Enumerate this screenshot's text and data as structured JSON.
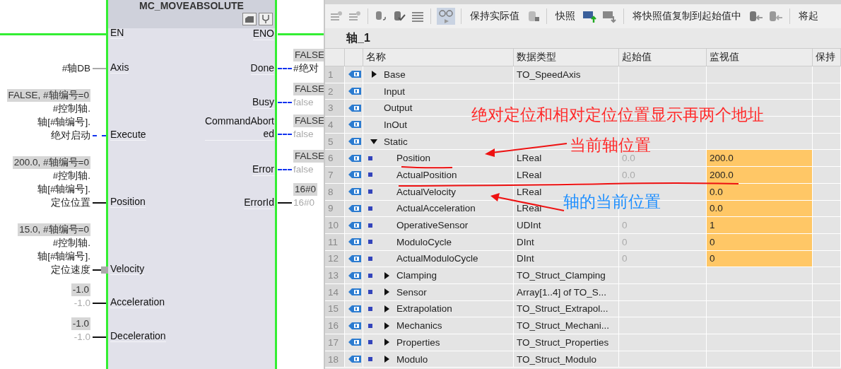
{
  "block": {
    "title": "MC_MOVEABSOLUTE",
    "inputs": [
      {
        "pin": "EN",
        "kind": "power"
      },
      {
        "pin": "Axis",
        "kind": "plain",
        "lines": [
          "#轴DB"
        ]
      },
      {
        "pin": "Execute",
        "kind": "dashed",
        "value": "FALSE, #轴编号=0",
        "lines": [
          "#控制轴.",
          "轴[#轴编号].",
          "绝对启动"
        ]
      },
      {
        "pin": "Position",
        "kind": "solid",
        "value": "200.0, #轴编号=0",
        "lines": [
          "#控制轴.",
          "轴[#轴编号].",
          "定位位置"
        ]
      },
      {
        "pin": "Velocity",
        "kind": "solid",
        "marker": true,
        "value": "15.0, #轴编号=0",
        "lines": [
          "#控制轴.",
          "轴[#轴编号].",
          "定位速度"
        ]
      },
      {
        "pin": "Acceleration",
        "kind": "solid",
        "value": "-1.0",
        "current": "-1.0"
      },
      {
        "pin": "Deceleration",
        "kind": "solid",
        "value": "-1.0",
        "current": "-1.0"
      }
    ],
    "outputs": [
      {
        "pin": "ENO",
        "kind": "power"
      },
      {
        "pin": "Done",
        "kind": "dashed",
        "value": "FALSE",
        "lines": [
          "#绝对"
        ]
      },
      {
        "pin": "Busy",
        "kind": "dashed",
        "value": "FALSE",
        "current": "false"
      },
      {
        "pin": "CommandAbort\ned",
        "kind": "dashed",
        "value": "FALSE",
        "current": "false"
      },
      {
        "pin": "Error",
        "kind": "dashed",
        "value": "FALSE",
        "current": "false"
      },
      {
        "pin": "ErrorId",
        "kind": "solid",
        "value": "16#0",
        "current": "16#0"
      }
    ]
  },
  "toolbar": {
    "monitor_on": true,
    "labels": [
      "保持实际值",
      "快照",
      "将快照值复制到起始值中",
      "将起"
    ]
  },
  "table": {
    "title": "轴_1",
    "columns": [
      "名称",
      "数据类型",
      "起始值",
      "监视值",
      "保持"
    ],
    "rows": [
      {
        "num": "1",
        "name": "Base",
        "expanded": false,
        "type": "TO_SpeedAxis"
      },
      {
        "num": "2",
        "name": "Input"
      },
      {
        "num": "3",
        "name": "Output"
      },
      {
        "num": "4",
        "name": "InOut"
      },
      {
        "num": "5",
        "name": "Static",
        "expanded": true,
        "children": [
          {
            "num": "6",
            "name": "Position",
            "type": "LReal",
            "start": "0.0",
            "monitor": "200.0",
            "monitored": true
          },
          {
            "num": "7",
            "name": "ActualPosition",
            "type": "LReal",
            "start": "0.0",
            "monitor": "200.0",
            "monitored": true
          },
          {
            "num": "8",
            "name": "ActualVelocity",
            "type": "LReal",
            "monitor": "0.0",
            "monitored": true
          },
          {
            "num": "9",
            "name": "ActualAcceleration",
            "type": "LReal",
            "monitor": "0.0",
            "monitored": true
          },
          {
            "num": "10",
            "name": "OperativeSensor",
            "type": "UDInt",
            "start": "0",
            "monitor": "1",
            "monitored": true
          },
          {
            "num": "11",
            "name": "ModuloCycle",
            "type": "DInt",
            "start": "0",
            "monitor": "0",
            "monitored": true
          },
          {
            "num": "12",
            "name": "ActualModuloCycle",
            "type": "DInt",
            "start": "0",
            "monitor": "0",
            "monitored": true
          },
          {
            "num": "13",
            "name": "Clamping",
            "expanded": false,
            "type": "TO_Struct_Clamping"
          },
          {
            "num": "14",
            "name": "Sensor",
            "expanded": false,
            "type": "Array[1..4] of TO_S..."
          },
          {
            "num": "15",
            "name": "Extrapolation",
            "expanded": false,
            "type": "TO_Struct_Extrapol..."
          },
          {
            "num": "16",
            "name": "Mechanics",
            "expanded": false,
            "type": "TO_Struct_Mechani..."
          },
          {
            "num": "17",
            "name": "Properties",
            "expanded": false,
            "type": "TO_Struct_Properties"
          },
          {
            "num": "18",
            "name": "Modulo",
            "expanded": false,
            "type": "TO_Struct_Modulo"
          }
        ]
      }
    ]
  },
  "annotations": [
    {
      "kind": "note",
      "text": "绝对定位和相对定位位置显示再两个地址",
      "color": "#ff2a2a"
    },
    {
      "kind": "arrow",
      "text": "当前轴位置",
      "color": "#ff2a2a"
    },
    {
      "kind": "arrow",
      "text": "轴的当前位置",
      "color": "#1e8fff"
    }
  ]
}
